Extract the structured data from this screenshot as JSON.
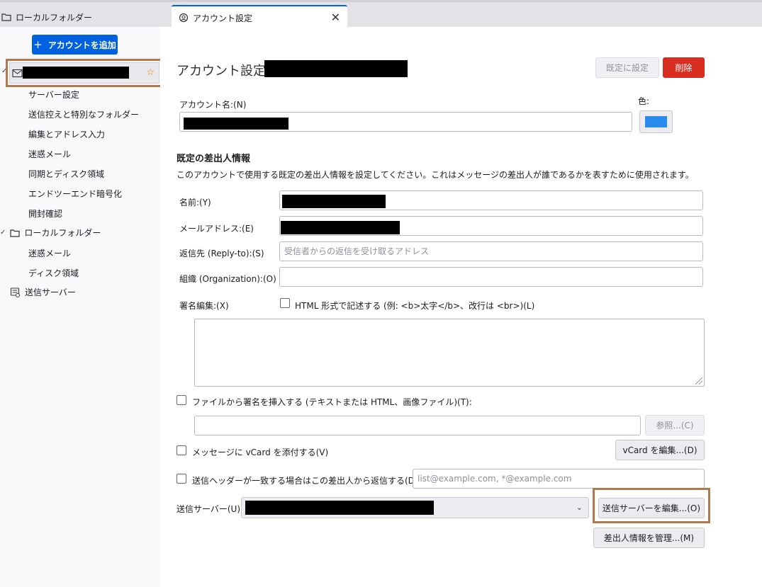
{
  "tabs": {
    "folder_tab_label": "ローカルフォルダー",
    "account_tab_label": "アカウント設定",
    "close_glyph": "✕"
  },
  "sidebar": {
    "add_account_label": "アカウントを追加",
    "add_icon": "+",
    "account_items": [
      {
        "label": "サーバー設定"
      },
      {
        "label": "送信控えと特別なフォルダー"
      },
      {
        "label": "編集とアドレス入力"
      },
      {
        "label": "迷惑メール"
      },
      {
        "label": "同期とディスク領域"
      },
      {
        "label": "エンドツーエンド暗号化"
      },
      {
        "label": "開封確認"
      }
    ],
    "local_folder_label": "ローカルフォルダー",
    "local_items": [
      {
        "label": "迷惑メール"
      },
      {
        "label": "ディスク領域"
      }
    ],
    "outgoing_server_label": "送信サーバー"
  },
  "main": {
    "title": "アカウント設定 -",
    "set_default_label": "既定に設定",
    "delete_label": "削除",
    "account_name_label": "アカウント名:(N)",
    "color_label": "色:",
    "account_color": "#2b8cf0",
    "identity_section_title": "既定の差出人情報",
    "identity_description": "このアカウントで使用する既定の差出人情報を設定してください。これはメッセージの差出人が誰であるかを表すために使用されます。",
    "name_label": "名前:(Y)",
    "email_label": "メールアドレス:(E)",
    "reply_to_label": "返信先 (Reply-to):(S)",
    "reply_to_placeholder": "受信者からの返信を受け取るアドレス",
    "organization_label": "組織 (Organization):(O)",
    "signature_label": "署名編集:(X)",
    "html_signature_label": "HTML 形式で記述する (例: <b>太字</b>、改行は <br>)(L)",
    "sig_file_label": "ファイルから署名を挿入する (テキストまたは HTML、画像ファイル)(T):",
    "browse_label": "参照...(C)",
    "vcard_label": "メッセージに vCard を添付する(V)",
    "vcard_edit_label": "vCard を編集...(D)",
    "reply_from_label": "送信ヘッダーが一致する場合はこの差出人から返信する(D):",
    "reply_from_placeholder": "list@example.com, *@example.com",
    "smtp_label": "送信サーバー(U):",
    "smtp_edit_label": "送信サーバーを編集...(O)",
    "manage_identities_label": "差出人情報を管理...(M)"
  }
}
